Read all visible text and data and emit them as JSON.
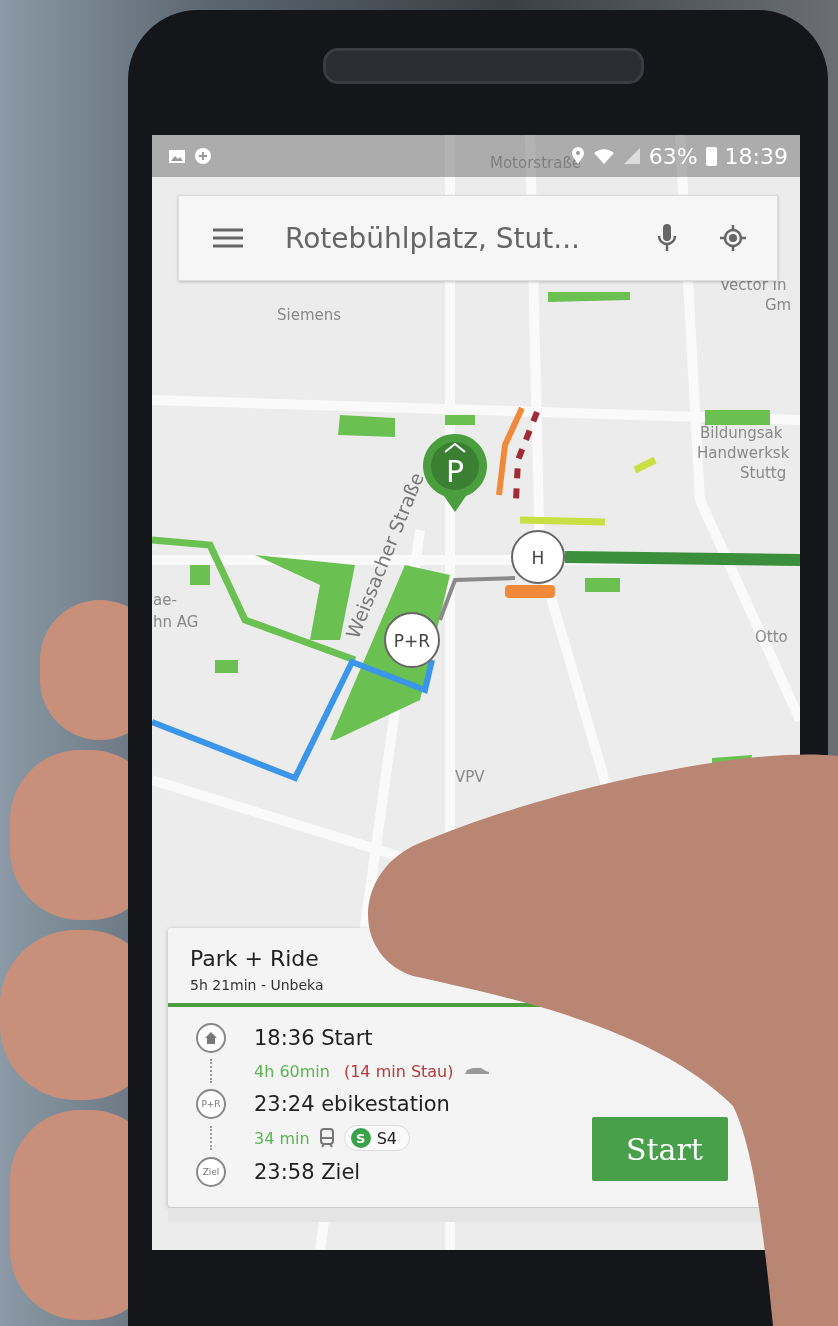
{
  "status_bar": {
    "battery": "63%",
    "time": "18:39"
  },
  "search": {
    "value": "Rotebühlplatz, Stut..."
  },
  "map": {
    "labels": [
      "Motorstraße",
      "Siemens",
      "Vector In",
      "Gm",
      "Weissacher Straße",
      "Bildungsak",
      "Handwerksk",
      "Stuttg",
      "ae-",
      "hn AG",
      "Otto",
      "VPV"
    ],
    "markers": [
      {
        "kind": "parking",
        "label": "P"
      },
      {
        "kind": "stop",
        "label": "H"
      },
      {
        "kind": "park_ride",
        "label": "P+R"
      }
    ]
  },
  "route_card": {
    "title": "Park + Ride",
    "subtitle": "5h 21min - Unbeka",
    "steps": [
      {
        "kind": "start",
        "text": "18:36 Start"
      },
      {
        "kind": "car_leg",
        "duration": "4h 60min",
        "delay": "(14 min Stau)"
      },
      {
        "kind": "stop",
        "badge": "P+R",
        "text": "23:24 ebikestation"
      },
      {
        "kind": "train_leg",
        "duration": "34 min",
        "line_badge": "S",
        "line": "S4"
      },
      {
        "kind": "stop",
        "badge": "Ziel",
        "text": "23:58 Ziel"
      }
    ],
    "start_button": "Start"
  }
}
